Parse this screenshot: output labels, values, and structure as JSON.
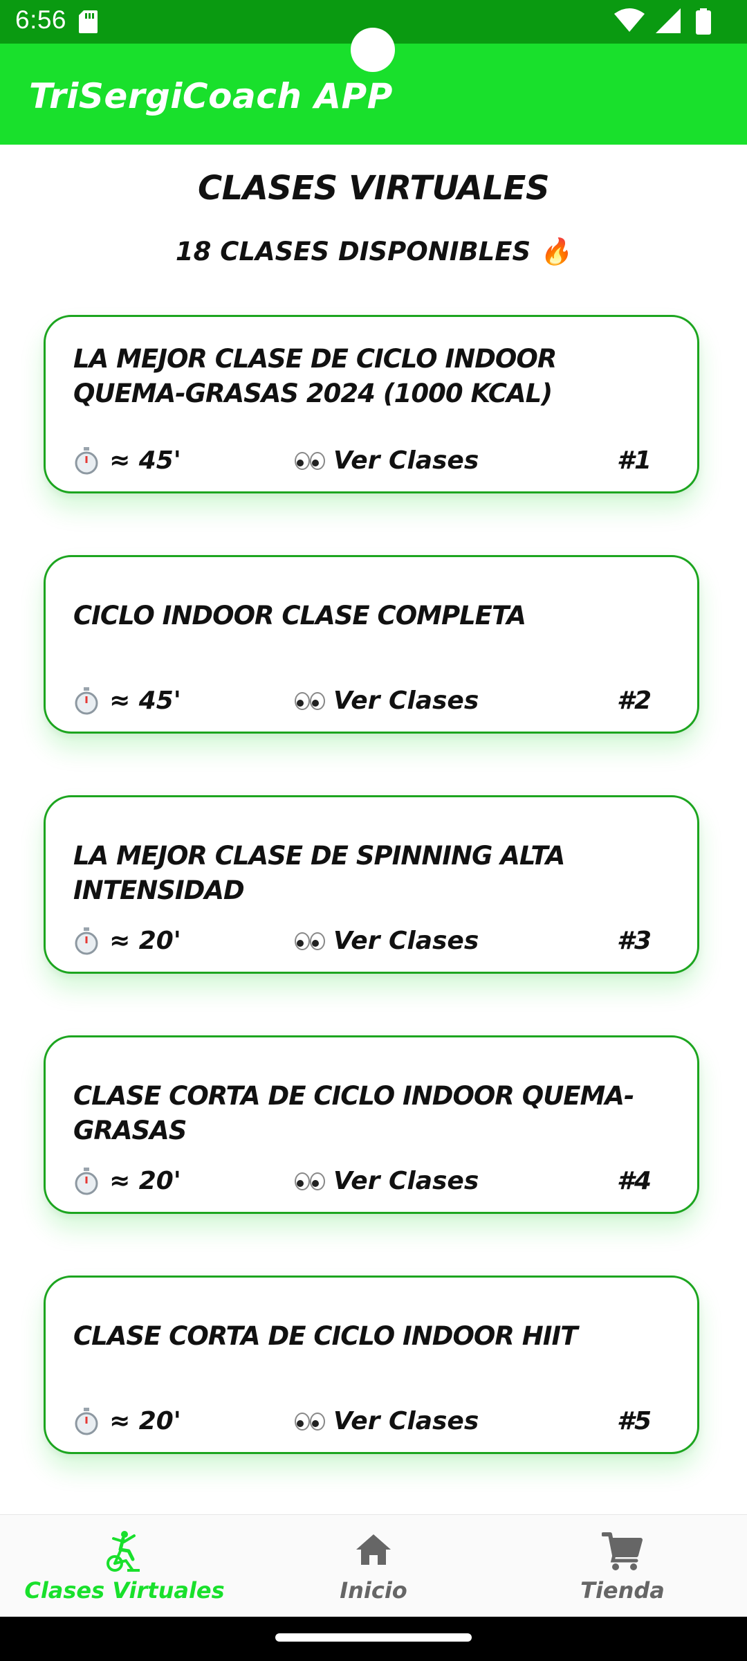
{
  "status_bar": {
    "time": "6:56",
    "icons": [
      "sd-card-icon",
      "wifi-icon",
      "cell-signal-icon",
      "battery-icon"
    ]
  },
  "app_bar": {
    "title": "TriSergiCoach APP",
    "background": "#19e02c"
  },
  "header": {
    "title": "CLASES VIRTUALES",
    "subtitle": "18 CLASES DISPONIBLES 🔥"
  },
  "cards": [
    {
      "title": "LA MEJOR CLASE DE CICLO INDOOR QUEMA-GRASAS 2024 (1000 KCAL)",
      "duration": "≈ 45'",
      "link": "Ver Clases",
      "number": "#1"
    },
    {
      "title": "CICLO INDOOR CLASE COMPLETA",
      "duration": "≈ 45'",
      "link": "Ver Clases",
      "number": "#2"
    },
    {
      "title": "LA MEJOR CLASE DE SPINNING ALTA INTENSIDAD",
      "duration": "≈ 20'",
      "link": "Ver Clases",
      "number": "#3"
    },
    {
      "title": "CLASE CORTA DE CICLO INDOOR QUEMA-GRASAS",
      "duration": "≈ 20'",
      "link": "Ver Clases",
      "number": "#4"
    },
    {
      "title": "CLASE CORTA DE CICLO INDOOR HIIT",
      "duration": "≈ 20'",
      "link": "Ver Clases",
      "number": "#5"
    }
  ],
  "bottom_nav": {
    "items": [
      {
        "label": "Clases Virtuales",
        "icon": "cycling-icon",
        "active": true
      },
      {
        "label": "Inicio",
        "icon": "home-icon",
        "active": false
      },
      {
        "label": "Tienda",
        "icon": "cart-icon",
        "active": false
      }
    ]
  },
  "colors": {
    "status_bar": "#0a9a11",
    "accent": "#19e02c",
    "card_border": "#1ca51f",
    "inactive_nav": "#666666"
  }
}
